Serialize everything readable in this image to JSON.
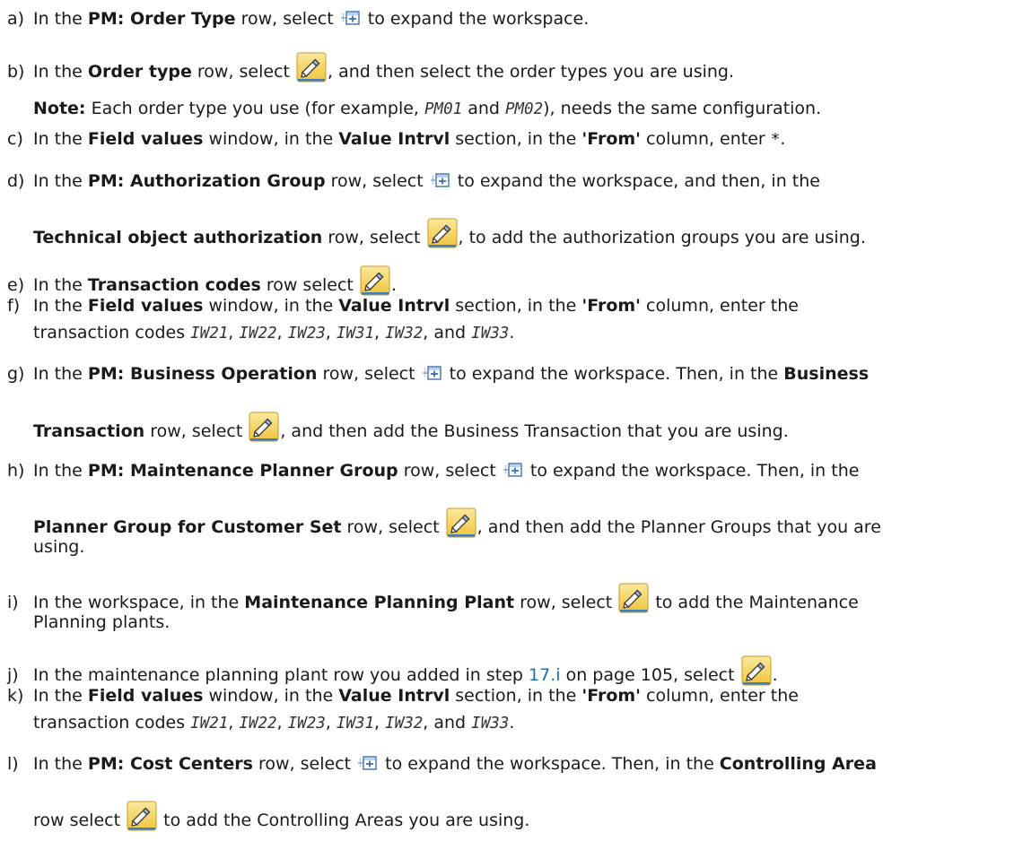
{
  "steps": [
    {
      "label": "a)",
      "t1": "In the ",
      "b1": "PM: Order Type",
      "t2": " row, select ",
      "t3": " to expand the workspace."
    },
    {
      "label": "b)",
      "t1": "In the ",
      "b1": "Order type",
      "t2": " row, select ",
      "t3": ", and then select the order types you are using.",
      "note_label": "Note:",
      "note_t1": " Each order type you use (for example, ",
      "note_c1": "PM01",
      "note_t2": " and ",
      "note_c2": "PM02",
      "note_t3": "), needs the same configuration."
    },
    {
      "label": "c)",
      "t1": "In the ",
      "b1": "Field values",
      "t2": " window, in the ",
      "b2": "Value Intrvl",
      "t3": " section, in the ",
      "b3": "'From'",
      "t4": " column, enter ",
      "c1": "*",
      "t5": "."
    },
    {
      "label": "d)",
      "t1": "In the ",
      "b1": "PM: Authorization Group",
      "t2": " row, select ",
      "t3": " to expand the workspace, and then, in the",
      "b2": "Technical object authorization",
      "t4": " row, select ",
      "t5": ", to add the authorization groups you are using."
    },
    {
      "label": "e)",
      "t1": "In the ",
      "b1": "Transaction codes",
      "t2": " row select ",
      "t3": "."
    },
    {
      "label": "f)",
      "t1": "In the ",
      "b1": "Field values",
      "t2": " window, in the ",
      "b2": "Value Intrvl",
      "t3": " section, in the ",
      "b3": "'From'",
      "t4": " column, enter the",
      "t5": "transaction codes ",
      "codes": [
        "IW21",
        "IW22",
        "IW23",
        "IW31",
        "IW32",
        "IW33"
      ],
      "sep": ", ",
      "and": ", and ",
      "end": "."
    },
    {
      "label": "g)",
      "t1": "In the ",
      "b1": "PM: Business Operation",
      "t2": " row, select ",
      "t3": " to expand the workspace. Then, in the ",
      "b2": "Business",
      "b3": "Transaction",
      "t4": " row, select ",
      "t5": ", and then add the Business Transaction that you are using."
    },
    {
      "label": "h)",
      "t1": "In the ",
      "b1": "PM: Maintenance Planner Group",
      "t2": " row, select ",
      "t3": " to expand the workspace. Then, in the",
      "b2": "Planner Group for Customer Set",
      "t4": " row, select ",
      "t5": ", and then add the Planner Groups that you are",
      "t6": "using."
    },
    {
      "label": "i)",
      "t1": "In the workspace, in the ",
      "b1": "Maintenance Planning Plant",
      "t2": " row, select ",
      "t3": " to add the Maintenance",
      "t4": "Planning plants."
    },
    {
      "label": "j)",
      "t1": "In the maintenance planning plant row you added in step ",
      "link": "17.i",
      "t2": " on page 105, select ",
      "t3": "."
    },
    {
      "label": "k)",
      "t1": "In the ",
      "b1": "Field values",
      "t2": " window, in the ",
      "b2": "Value Intrvl",
      "t3": " section, in the ",
      "b3": "'From'",
      "t4": " column, enter the",
      "t5": "transaction codes ",
      "codes": [
        "IW21",
        "IW22",
        "IW23",
        "IW31",
        "IW32",
        "IW33"
      ],
      "sep": ", ",
      "and": ", and ",
      "end": "."
    },
    {
      "label": "l)",
      "t1": "In the ",
      "b1": "PM: Cost Centers",
      "t2": " row, select ",
      "t3": " to expand the workspace. Then, in the ",
      "b2": "Controlling Area",
      "t4": "row select ",
      "t5": " to add the Controlling Areas you are using."
    }
  ],
  "icons": {
    "expand": "expand-workspace-icon",
    "edit": "pencil-edit-icon"
  },
  "colors": {
    "link": "#1a6fb5",
    "pencil_bg": "#f3d35a"
  }
}
